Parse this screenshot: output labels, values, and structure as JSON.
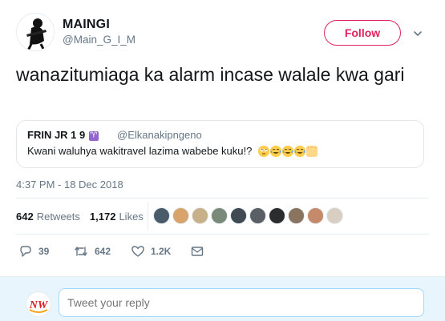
{
  "tweet": {
    "author_name": "MAINGI",
    "author_handle": "@Main_G_I_M",
    "follow_label": "Follow",
    "text": "wanazitumiaga ka alarm incase walale kwa gari",
    "timestamp": "4:37 PM - 18 Dec 2018"
  },
  "quote": {
    "name": "FRIN JR 1 9",
    "badge": "♈",
    "handle": "@Elkanakipngeno",
    "text": "Kwani waluhya wakitravel lazima wabebe kuku!?",
    "emoji_icons": [
      "face-with-rolling-eyes",
      "face-with-tears-of-joy",
      "face-with-tears-of-joy",
      "face-with-tears-of-joy",
      "raising-hands"
    ]
  },
  "stats": {
    "retweets_count": "642",
    "retweets_label": "Retweets",
    "likes_count": "1,172",
    "likes_label": "Likes",
    "liker_avatars": [
      "#4a5c6a",
      "#d9a46c",
      "#c7b08a",
      "#7a8a7a",
      "#3f4a52",
      "#5a5f66",
      "#2c2c2c",
      "#8a7460",
      "#c58a6a",
      "#d8cfc2"
    ]
  },
  "actions": {
    "reply_count": "39",
    "retweet_count": "642",
    "like_count": "1.2K"
  },
  "reply": {
    "placeholder": "Tweet your reply",
    "avatar_text": "NW"
  },
  "colors": {
    "follow": "#e0245e",
    "secondary_text": "#657786",
    "reply_bg": "#e8f5fd"
  }
}
